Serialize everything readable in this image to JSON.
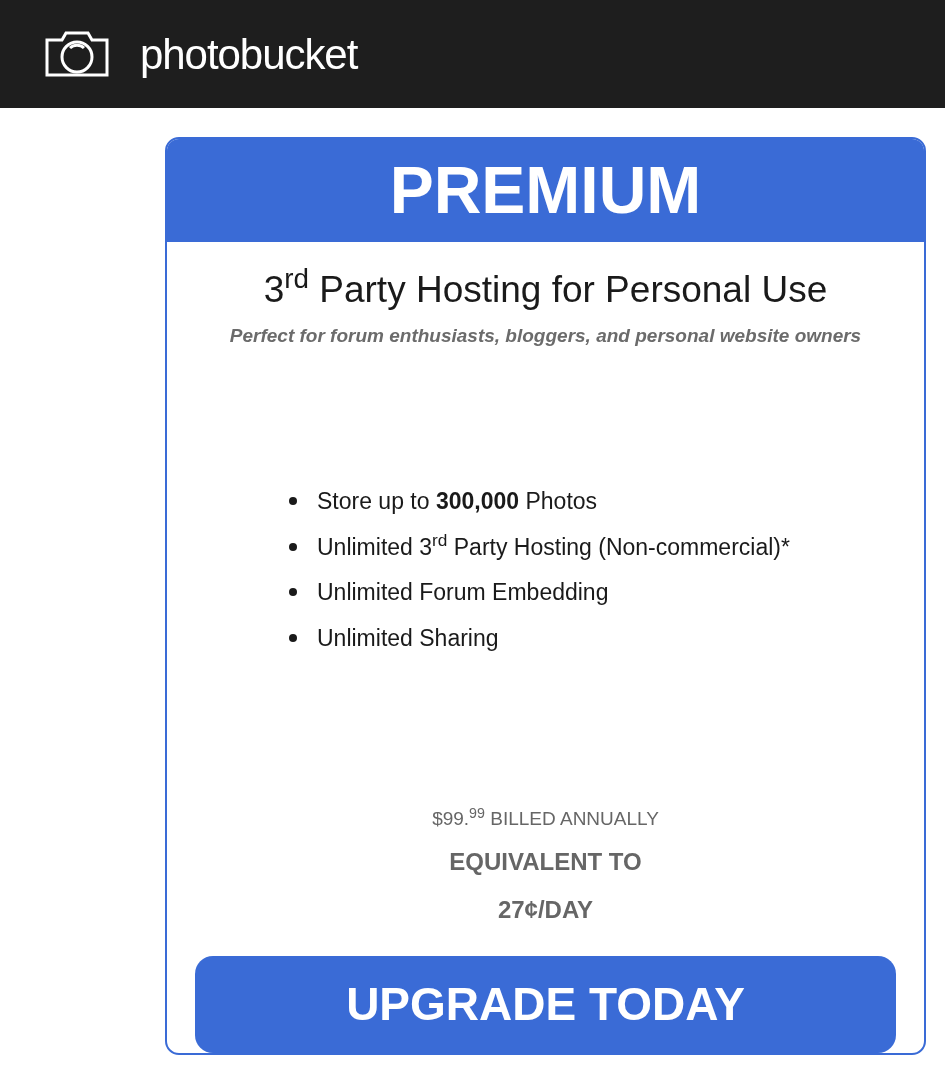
{
  "header": {
    "brand": "photobucket"
  },
  "plan": {
    "name": "PREMIUM",
    "title": "3$^{rd}$ Party Hosting for Personal Use",
    "subtitle": "Perfect for forum enthusiasts, bloggers, and personal website owners",
    "features": [
      "Store up to **300,000** Photos",
      "Unlimited 3$^{rd}$ Party Hosting (Non-commercial)*",
      "Unlimited Forum Embedding",
      "Unlimited Sharing"
    ],
    "price": "$99.$^{99}$ BILLED ANNUALLY",
    "equivalent": [
      "EQUIVALENT TO",
      "27¢/DAY"
    ],
    "button": "UPGRADE TODAY"
  }
}
